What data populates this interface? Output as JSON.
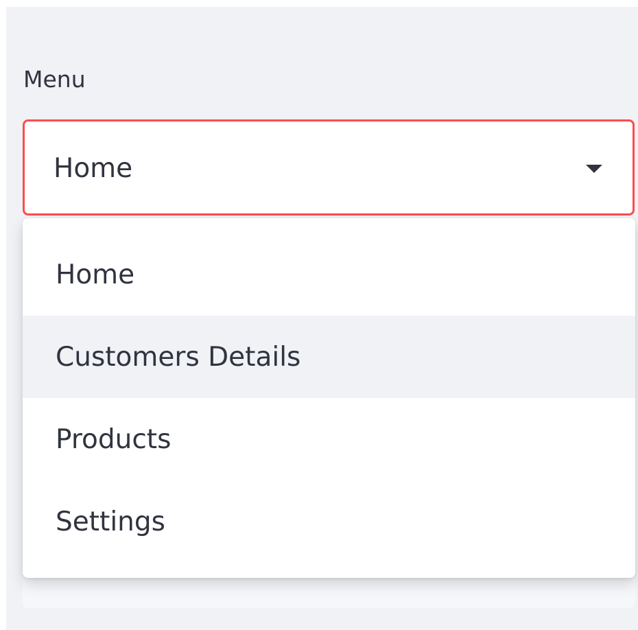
{
  "sidebar": {
    "menu": {
      "label": "Menu",
      "selected": "Home",
      "options": [
        {
          "label": "Home"
        },
        {
          "label": "Customers Details"
        },
        {
          "label": "Products"
        },
        {
          "label": "Settings"
        }
      ],
      "highlighted_option": "Customers Details",
      "focus_border_color": "#ff4b4b",
      "highlight_color": "#f0f2f6",
      "caret_icon": "caret-down-icon"
    }
  }
}
